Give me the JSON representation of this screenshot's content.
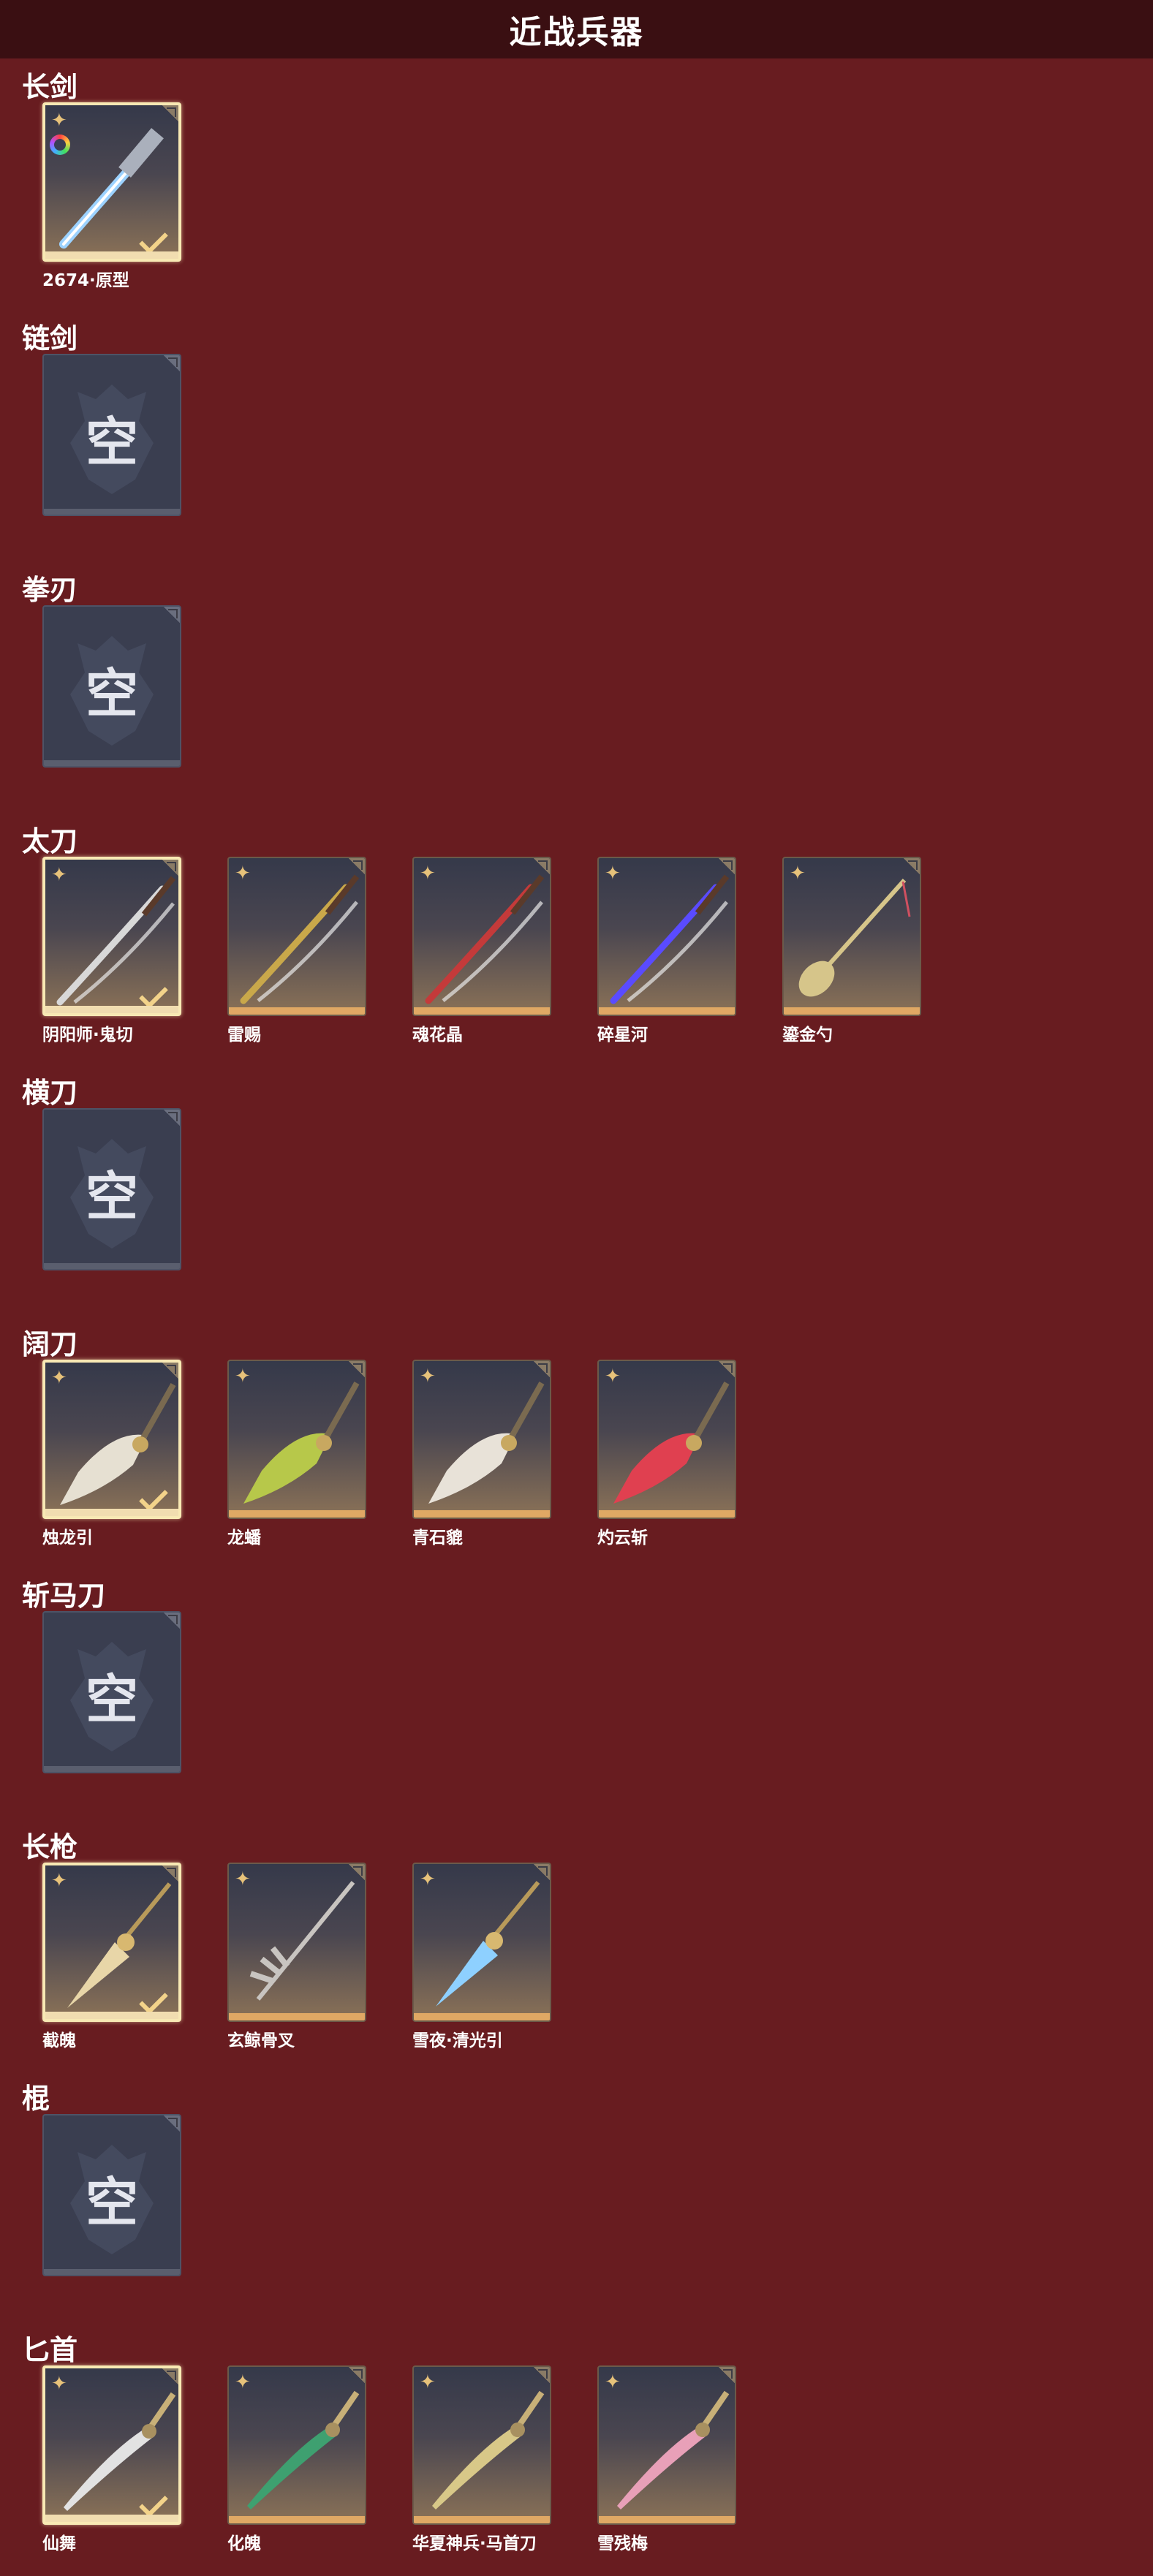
{
  "header": {
    "title": "近战兵器"
  },
  "empty_label": "空",
  "categories": [
    {
      "name": "长剑",
      "items": [
        {
          "name": "2674·原型",
          "equipped": true,
          "rainbow": true,
          "icon": "sword-icon",
          "color": "#9cd2ff"
        }
      ]
    },
    {
      "name": "链剑",
      "items": []
    },
    {
      "name": "拳刃",
      "items": []
    },
    {
      "name": "太刀",
      "items": [
        {
          "name": "阴阳师·鬼切",
          "equipped": true,
          "icon": "katana-icon",
          "color": "#d8d8d8"
        },
        {
          "name": "雷赐",
          "equipped": false,
          "icon": "katana-icon",
          "color": "#c9a84a"
        },
        {
          "name": "魂花晶",
          "equipped": false,
          "icon": "katana-icon",
          "color": "#c43a3a"
        },
        {
          "name": "碎星河",
          "equipped": false,
          "icon": "katana-icon",
          "color": "#5a4bff"
        },
        {
          "name": "鎏金勺",
          "equipped": false,
          "icon": "spoon-icon",
          "color": "#d6c58a"
        }
      ]
    },
    {
      "name": "横刀",
      "items": []
    },
    {
      "name": "阔刀",
      "items": [
        {
          "name": "烛龙引",
          "equipped": true,
          "icon": "broadsword-icon",
          "color": "#e6e0d2"
        },
        {
          "name": "龙蟠",
          "equipped": false,
          "icon": "broadsword-icon",
          "color": "#b7c84a"
        },
        {
          "name": "青石貔",
          "equipped": false,
          "icon": "broadsword-icon",
          "color": "#e8e2d8"
        },
        {
          "name": "灼云斩",
          "equipped": false,
          "icon": "broadsword-icon",
          "color": "#e04050"
        }
      ]
    },
    {
      "name": "斩马刀",
      "items": []
    },
    {
      "name": "长枪",
      "items": [
        {
          "name": "截魄",
          "equipped": true,
          "icon": "spear-icon",
          "color": "#e8d6a8"
        },
        {
          "name": "玄鲸骨叉",
          "equipped": false,
          "icon": "trident-icon",
          "color": "#c8c4c0"
        },
        {
          "name": "雪夜·清光引",
          "equipped": false,
          "icon": "spear-icon",
          "color": "#8ed0ff"
        }
      ]
    },
    {
      "name": "棍",
      "items": []
    },
    {
      "name": "匕首",
      "items": [
        {
          "name": "仙舞",
          "equipped": true,
          "icon": "dagger-icon",
          "color": "#e2e2e2"
        },
        {
          "name": "化魄",
          "equipped": false,
          "icon": "dagger-icon",
          "color": "#3ea070"
        },
        {
          "name": "华夏神兵·马首刀",
          "equipped": false,
          "icon": "dagger-icon",
          "color": "#d8c888"
        },
        {
          "name": "雪残梅",
          "equipped": false,
          "icon": "dagger-icon",
          "color": "#e8a0b8"
        }
      ]
    }
  ]
}
